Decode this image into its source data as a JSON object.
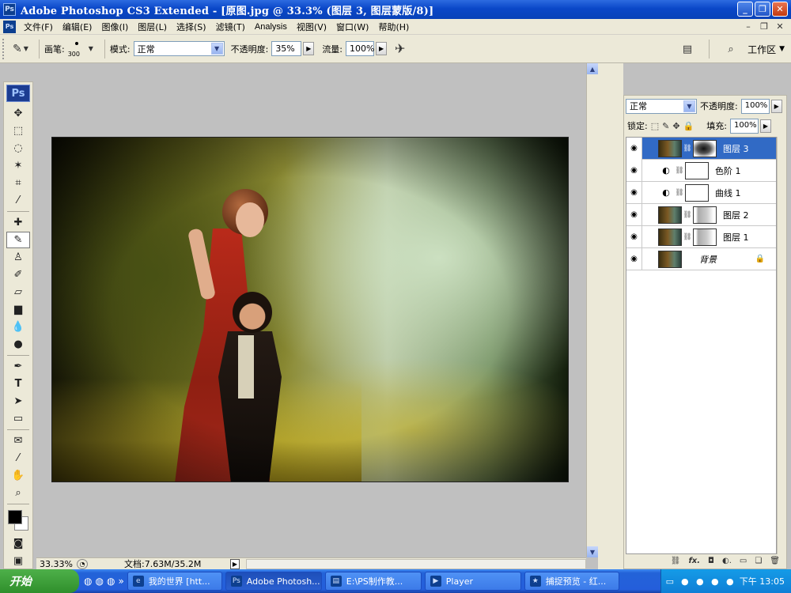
{
  "window": {
    "app_badge": "Ps",
    "title": "Adobe Photoshop CS3 Extended - [原图.jpg @ 33.3% (图层 3, 图层蒙版/8)]"
  },
  "menu": {
    "items": [
      "文件(F)",
      "编辑(E)",
      "图像(I)",
      "图层(L)",
      "选择(S)",
      "滤镜(T)",
      "Analysis",
      "视图(V)",
      "窗口(W)",
      "帮助(H)"
    ]
  },
  "options": {
    "brush_label": "画笔:",
    "brush_size": "300",
    "mode_label": "模式:",
    "mode_value": "正常",
    "opacity_label": "不透明度:",
    "opacity_value": "35%",
    "flow_label": "流量:",
    "flow_value": "100%",
    "workspace_label": "工作区"
  },
  "toolbox": {
    "badge": "Ps"
  },
  "status": {
    "zoom": "33.33%",
    "doc_info": "文档:7.63M/35.2M"
  },
  "layers_panel": {
    "blend_mode": "正常",
    "opacity_label": "不透明度:",
    "opacity_value": "100%",
    "lock_label": "锁定:",
    "fill_label": "填充:",
    "fill_value": "100%",
    "layers": [
      {
        "name": "图层 3",
        "selected": true
      },
      {
        "name": "色阶 1",
        "selected": false
      },
      {
        "name": "曲线 1",
        "selected": false
      },
      {
        "name": "图层 2",
        "selected": false
      },
      {
        "name": "图层 1",
        "selected": false
      },
      {
        "name": "背景",
        "selected": false
      }
    ]
  },
  "taskbar": {
    "start_label": "开始",
    "tasks": [
      "我的世界 [htt...",
      "Adobe Photosh...",
      "E:\\PS制作教...",
      "Player",
      "捕捉预览 - 红..."
    ],
    "clock": "下午 13:05"
  },
  "colors": {
    "title_blue": "#0a47c8",
    "selection_blue": "#316ac5",
    "panel_gray": "#ece9d8"
  }
}
